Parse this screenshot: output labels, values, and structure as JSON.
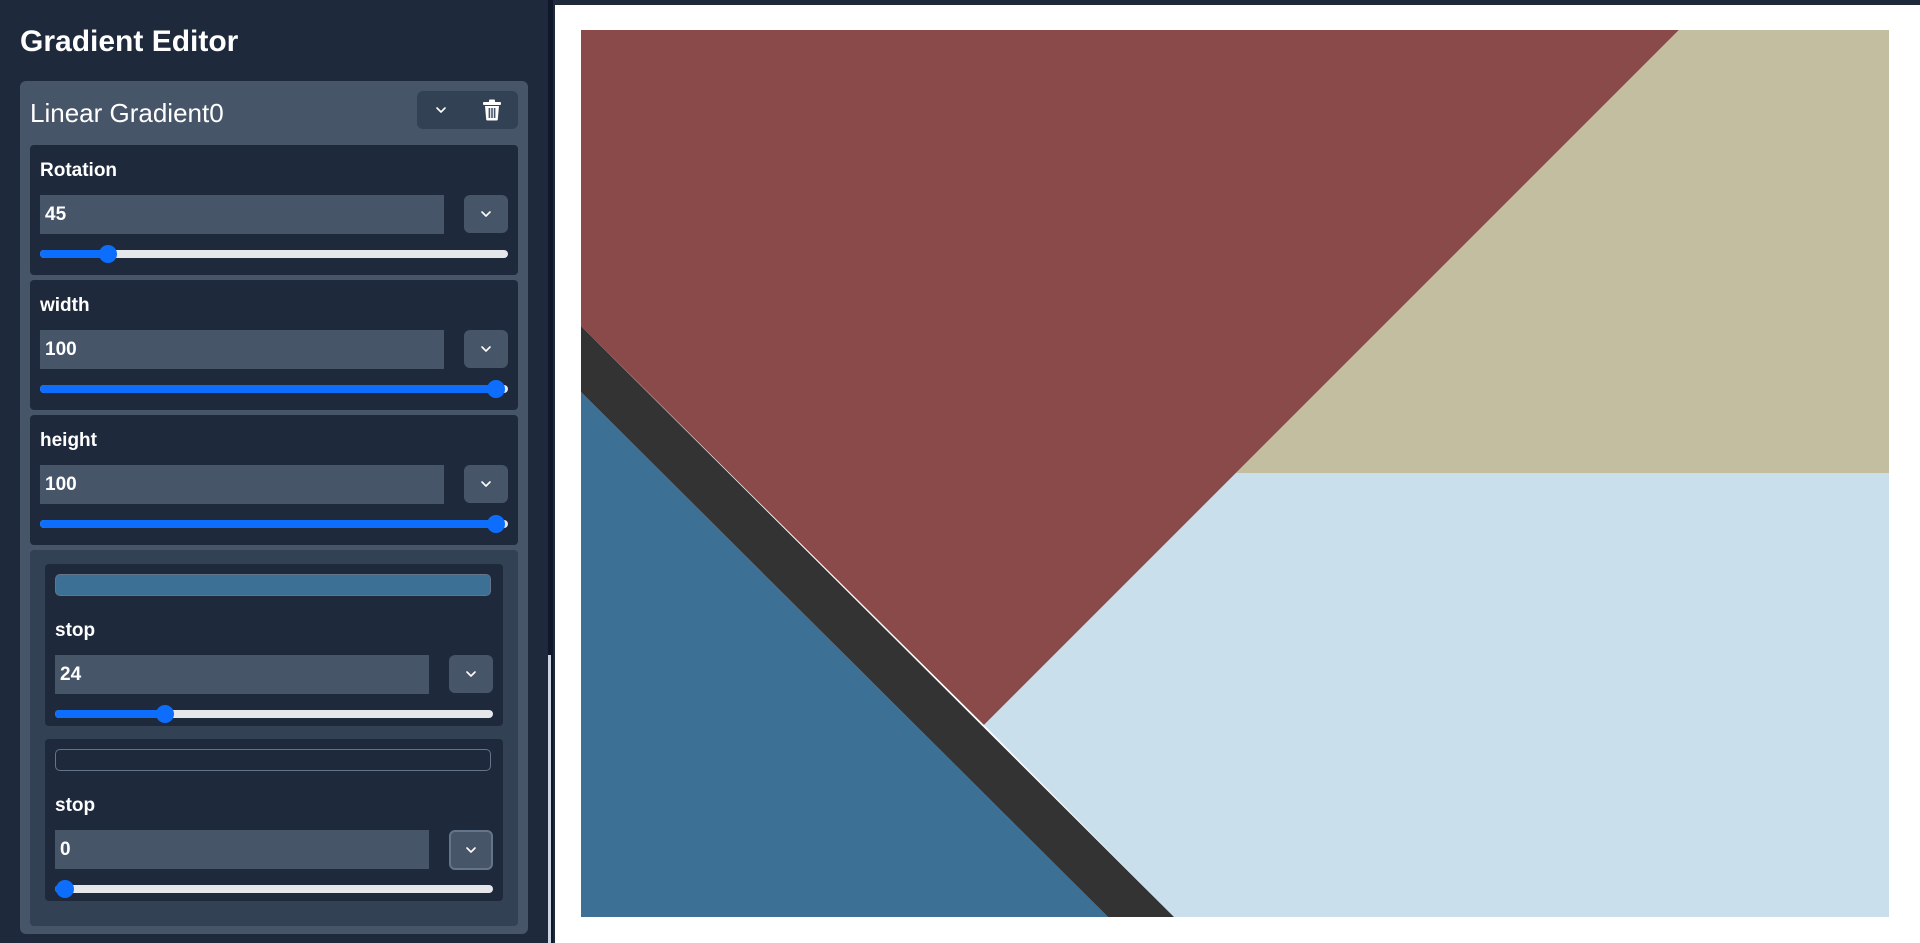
{
  "app": {
    "title": "Gradient Editor"
  },
  "gradient": {
    "name": "Linear Gradient0",
    "collapse_icon": "chevron-down-icon",
    "delete_icon": "trash-icon",
    "rotation": {
      "label": "Rotation",
      "value": "45",
      "min": 0,
      "max": 360,
      "fraction": 0.125
    },
    "width": {
      "label": "width",
      "value": "100",
      "min": 0,
      "max": 100,
      "fraction": 1.0
    },
    "height": {
      "label": "height",
      "value": "100",
      "min": 0,
      "max": 100,
      "fraction": 1.0
    },
    "stops": [
      {
        "label": "stop",
        "value": "24",
        "color": "#3c7094",
        "fraction": 0.24
      },
      {
        "label": "stop",
        "value": "0",
        "color": "#1e293b",
        "fraction": 0.0
      }
    ]
  },
  "colors": {
    "sidebar_bg": "#1e293b",
    "card_bg": "#475569",
    "accent": "#0d6efd",
    "preview_red": "#8a4a4a",
    "preview_tan": "#c4bea0",
    "preview_lightblue": "#c9e0ec",
    "preview_blue": "#3c7094",
    "preview_band": "#333333"
  }
}
